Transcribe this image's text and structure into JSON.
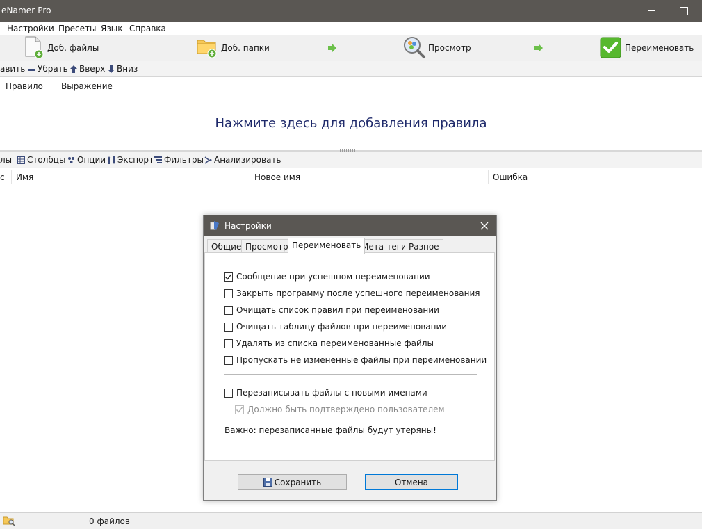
{
  "window": {
    "title": "eNamer Pro"
  },
  "menu": [
    "Настройки",
    "Пресеты",
    "Язык",
    "Справка"
  ],
  "main_toolbar": {
    "add_files": "Доб. файлы",
    "add_folders": "Доб. папки",
    "preview": "Просмотр",
    "rename": "Переименовать"
  },
  "rules_toolbar": {
    "add": "авить",
    "remove": "Убрать",
    "up": "Вверх",
    "down": "Вниз"
  },
  "rules_table": {
    "columns": [
      "Правило",
      "Выражение"
    ],
    "empty_hint": "Нажмите здесь для добавления правила"
  },
  "files_toolbar": {
    "files": "лы",
    "columns": "Столбцы",
    "options": "Опции",
    "export": "Экспорт",
    "filters": "Фильтры",
    "analyze": "Анализировать"
  },
  "files_table": {
    "columns": [
      "с",
      "Имя",
      "Новое имя",
      "Ошибка"
    ]
  },
  "status": {
    "file_count": "0 файлов"
  },
  "dialog": {
    "title": "Настройки",
    "tabs": [
      "Общие",
      "Просмотр",
      "Переименовать",
      "Мета-теги",
      "Разное"
    ],
    "active_tab": "Переименовать",
    "options": [
      {
        "label": "Сообщение при успешном переименовании",
        "checked": true
      },
      {
        "label": "Закрыть программу после успешного переименования",
        "checked": false
      },
      {
        "label": "Очищать список правил при переименовании",
        "checked": false
      },
      {
        "label": "Очищать таблицу файлов при переименовании",
        "checked": false
      },
      {
        "label": "Удалять из списка переименованные файлы",
        "checked": false
      },
      {
        "label": "Пропускать не измененные файлы при переименовании",
        "checked": false
      }
    ],
    "overwrite": {
      "label": "Перезаписывать файлы с новыми именами",
      "checked": false
    },
    "confirm": {
      "label": "Должно быть подтверждено пользователем",
      "checked": true,
      "disabled": true
    },
    "warning": "Важно: перезаписанные файлы будут утеряны!",
    "save_button": "Сохранить",
    "cancel_button": "Отмена"
  },
  "colors": {
    "titlebar": "#5a5753",
    "accent_blue": "#0078d7",
    "hint_text": "#1f2a6b",
    "arrow_green": "#6cc04a",
    "rename_green": "#57b82e"
  }
}
